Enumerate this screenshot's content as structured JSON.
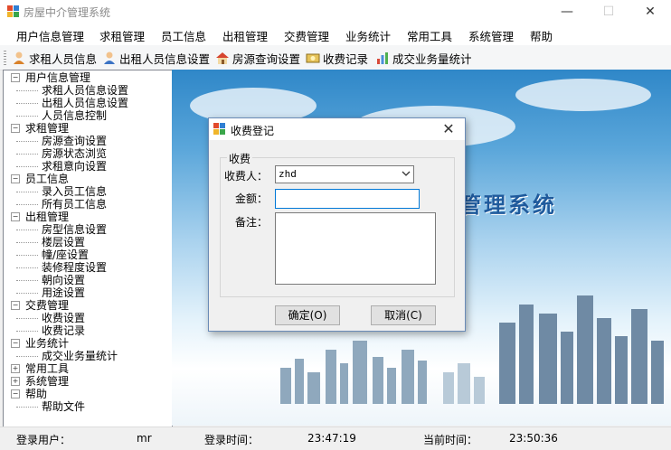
{
  "window": {
    "title": "房屋中介管理系统",
    "minimize": "—",
    "maximize": "☐",
    "close": "✕"
  },
  "menu": [
    "用户信息管理",
    "求租管理",
    "员工信息",
    "出租管理",
    "交费管理",
    "业务统计",
    "常用工具",
    "系统管理",
    "帮助"
  ],
  "toolbar": [
    {
      "label": "求租人员信息",
      "icon": "person-icon"
    },
    {
      "label": "出租人员信息设置",
      "icon": "person-icon"
    },
    {
      "label": "房源查询设置",
      "icon": "house-icon"
    },
    {
      "label": "收费记录",
      "icon": "money-icon"
    },
    {
      "label": "成交业务量统计",
      "icon": "chart-icon"
    }
  ],
  "tree": [
    {
      "label": "用户信息管理",
      "level": 0,
      "expander": "−"
    },
    {
      "label": "求租人员信息设置",
      "level": 1
    },
    {
      "label": "出租人员信息设置",
      "level": 1
    },
    {
      "label": "人员信息控制",
      "level": 1
    },
    {
      "label": "求租管理",
      "level": 0,
      "expander": "−"
    },
    {
      "label": "房源查询设置",
      "level": 1
    },
    {
      "label": "房源状态浏览",
      "level": 1
    },
    {
      "label": "求租意向设置",
      "level": 1
    },
    {
      "label": "员工信息",
      "level": 0,
      "expander": "−"
    },
    {
      "label": "录入员工信息",
      "level": 1
    },
    {
      "label": "所有员工信息",
      "level": 1
    },
    {
      "label": "出租管理",
      "level": 0,
      "expander": "−"
    },
    {
      "label": "房型信息设置",
      "level": 1
    },
    {
      "label": "楼层设置",
      "level": 1
    },
    {
      "label": "幢/座设置",
      "level": 1
    },
    {
      "label": "装修程度设置",
      "level": 1
    },
    {
      "label": "朝向设置",
      "level": 1
    },
    {
      "label": "用途设置",
      "level": 1
    },
    {
      "label": "交费管理",
      "level": 0,
      "expander": "−"
    },
    {
      "label": "收费设置",
      "level": 1
    },
    {
      "label": "收费记录",
      "level": 1
    },
    {
      "label": "业务统计",
      "level": 0,
      "expander": "−"
    },
    {
      "label": "成交业务量统计",
      "level": 1
    },
    {
      "label": "常用工具",
      "level": 0,
      "expander": "+"
    },
    {
      "label": "系统管理",
      "level": 0,
      "expander": "+"
    },
    {
      "label": "帮助",
      "level": 0,
      "expander": "−"
    },
    {
      "label": "帮助文件",
      "level": 1
    }
  ],
  "banner": "管理系统",
  "status": {
    "user_label": "登录用户：",
    "user_value": "mr",
    "login_label": "登录时间：",
    "login_value": "23:47:19",
    "now_label": "当前时间：",
    "now_value": "23:50:36"
  },
  "dialog": {
    "title": "收费登记",
    "close": "✕",
    "group": "收费",
    "payer_label": "收费人：",
    "payer_value": "zhd",
    "amount_label": "金额：",
    "amount_value": "",
    "note_label": "备注：",
    "note_value": "",
    "ok": "确定(O)",
    "cancel": "取消(C)"
  },
  "colors": {
    "accent": "#0078d7",
    "banner": "#1f5a9c"
  }
}
